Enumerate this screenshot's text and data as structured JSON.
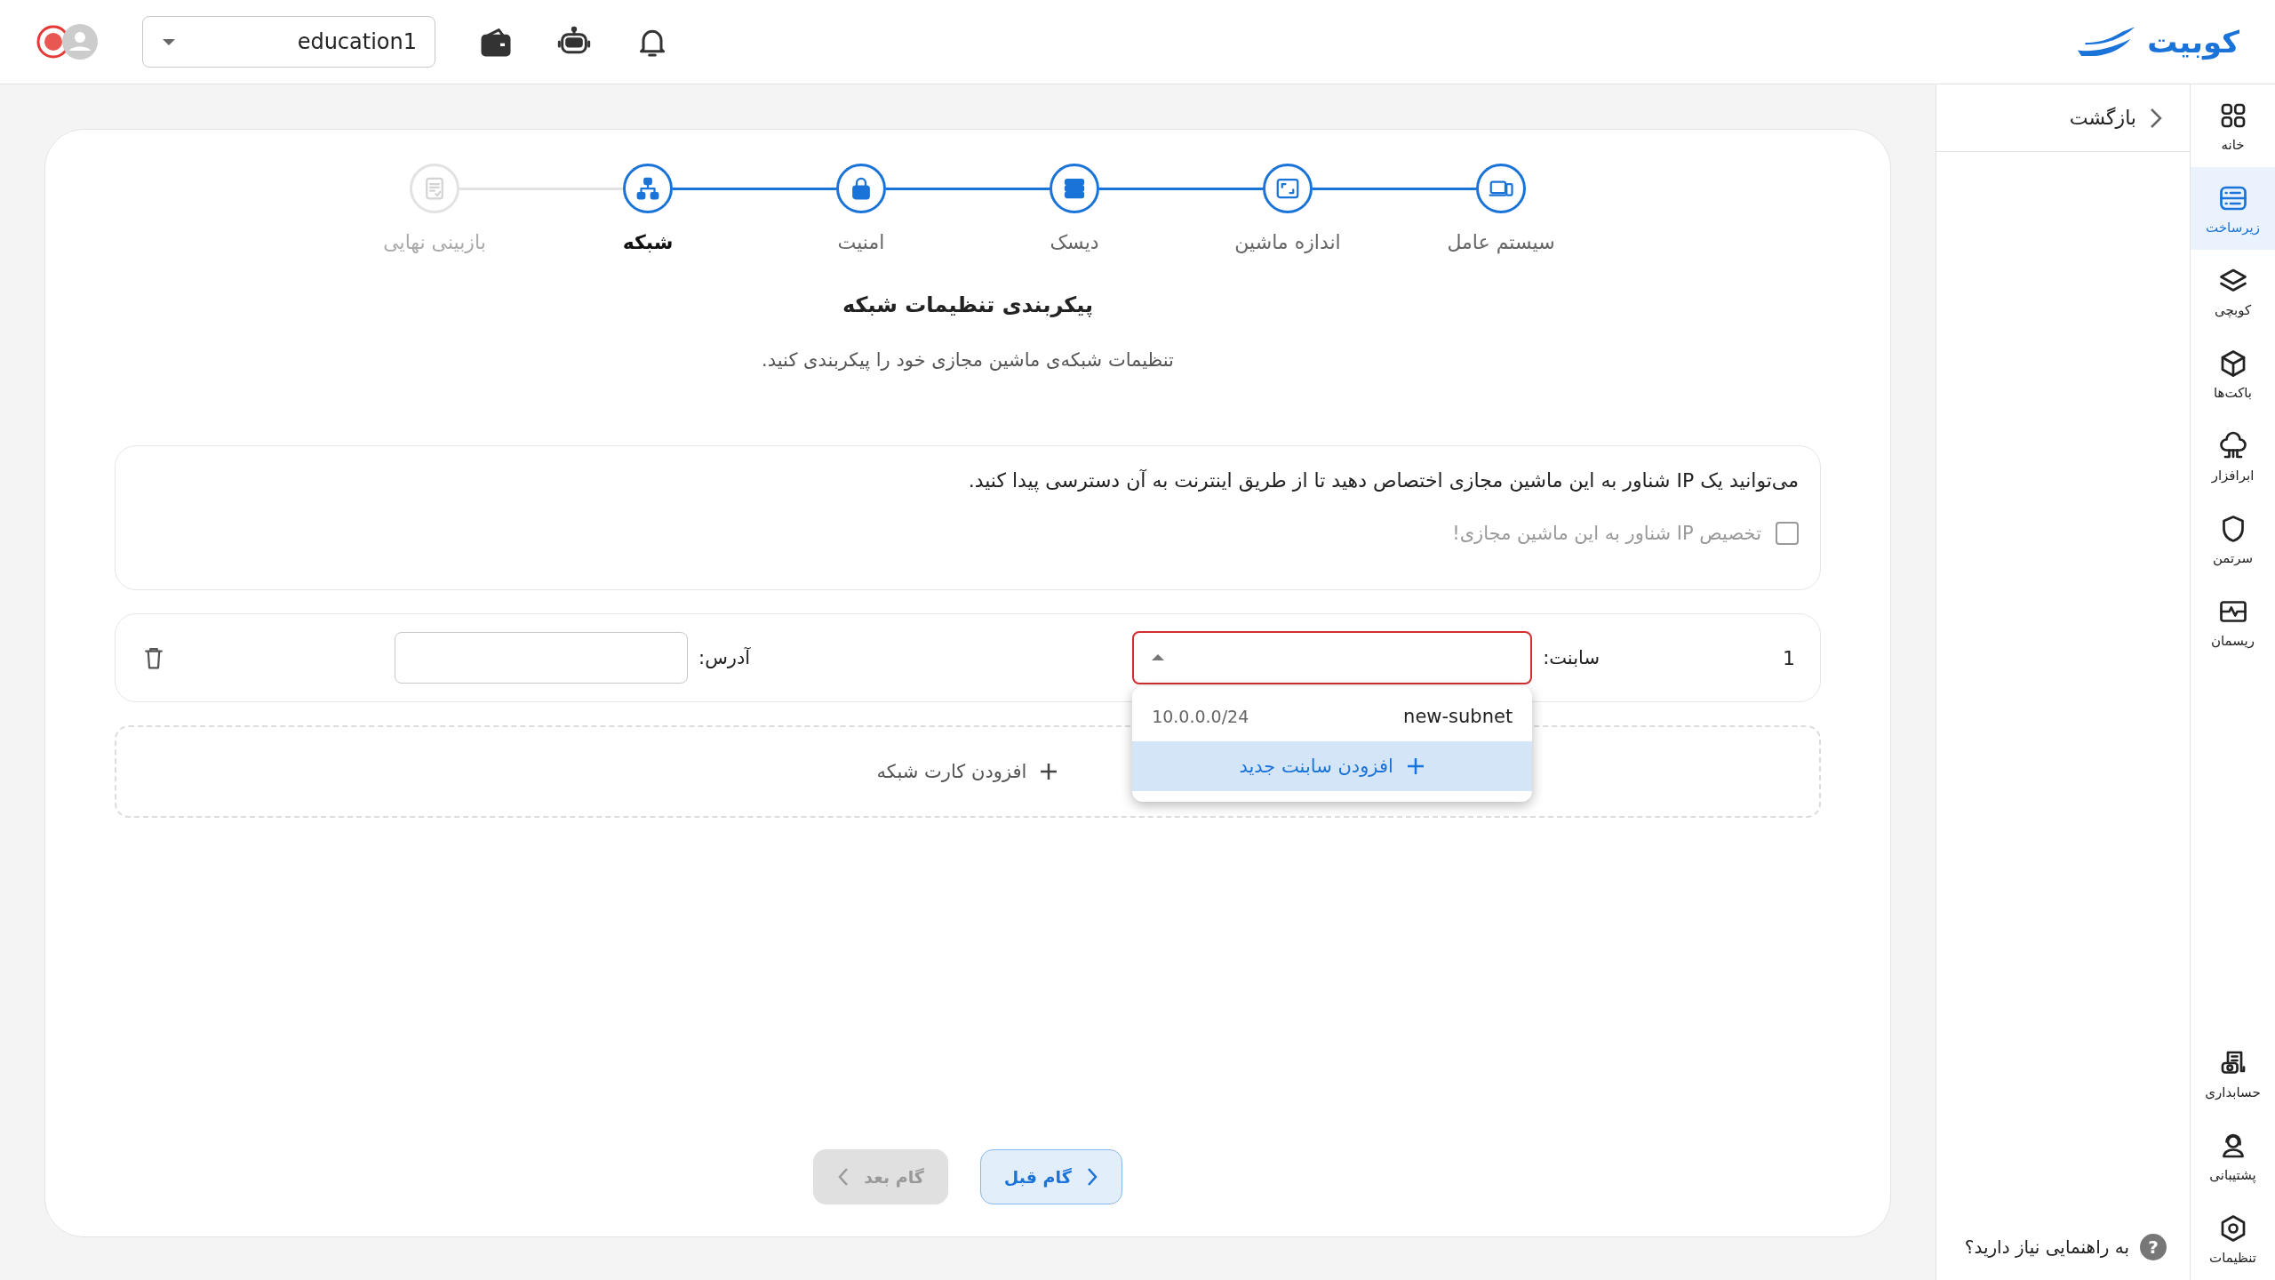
{
  "header": {
    "logo_text": "کوبیت",
    "project": "education1"
  },
  "nav": {
    "items": [
      {
        "label": "خانه",
        "selected": false
      },
      {
        "label": "زیرساخت",
        "selected": true
      },
      {
        "label": "کوبچی",
        "selected": false
      },
      {
        "label": "باکت‌ها",
        "selected": false
      },
      {
        "label": "ابرافزار",
        "selected": false
      },
      {
        "label": "سرتمن",
        "selected": false
      },
      {
        "label": "ریسمان",
        "selected": false
      }
    ],
    "bottom_items": [
      {
        "label": "حسابداری",
        "selected": false
      },
      {
        "label": "پشتیبانی",
        "selected": false
      },
      {
        "label": "تنظیمات",
        "selected": false
      }
    ]
  },
  "side_panel": {
    "back": "بازگشت",
    "help": "به راهنمایی نیاز دارید؟",
    "help_icon": "?"
  },
  "steps": [
    {
      "label": "سیستم عامل",
      "disabled": false,
      "selected": false
    },
    {
      "label": "اندازه ماشین",
      "disabled": false,
      "selected": false
    },
    {
      "label": "دیسک",
      "disabled": false,
      "selected": false
    },
    {
      "label": "امنیت",
      "disabled": false,
      "selected": false
    },
    {
      "label": "شبکه",
      "disabled": false,
      "selected": true
    },
    {
      "label": "بازبینی نهایی",
      "disabled": true,
      "selected": false
    }
  ],
  "title": "پیکربندی تنظیمات شبکه",
  "subtitle": "تنظیمات شبکه‌ی ماشین مجازی خود را پیکربندی کنید.",
  "floating_ip": {
    "description": "می‌توانید یک IP شناور به این ماشین مجازی اختصاص دهید تا از طریق اینترنت به آن دسترسی پیدا کنید.",
    "checkbox_label": "تخصیص IP شناور به این ماشین مجازی!",
    "checked": false
  },
  "network_cards": [
    {
      "index": "1",
      "subnet_label": "سابنت:",
      "address_label": "آدرس:",
      "subnet_error": true,
      "expanded": true,
      "options": [
        {
          "kind": "option",
          "cidr": "10.0.0.0/24",
          "name": "new-subnet",
          "selected": false
        },
        {
          "kind": "add",
          "label": "افزودن سابنت جدید",
          "selected": true
        }
      ]
    }
  ],
  "add_card": "افزودن کارت شبکه",
  "buttons": [
    {
      "label": "گام قبل",
      "kind": "previous",
      "disabled": false
    },
    {
      "label": "گام بعد",
      "kind": "next",
      "disabled": true
    }
  ]
}
